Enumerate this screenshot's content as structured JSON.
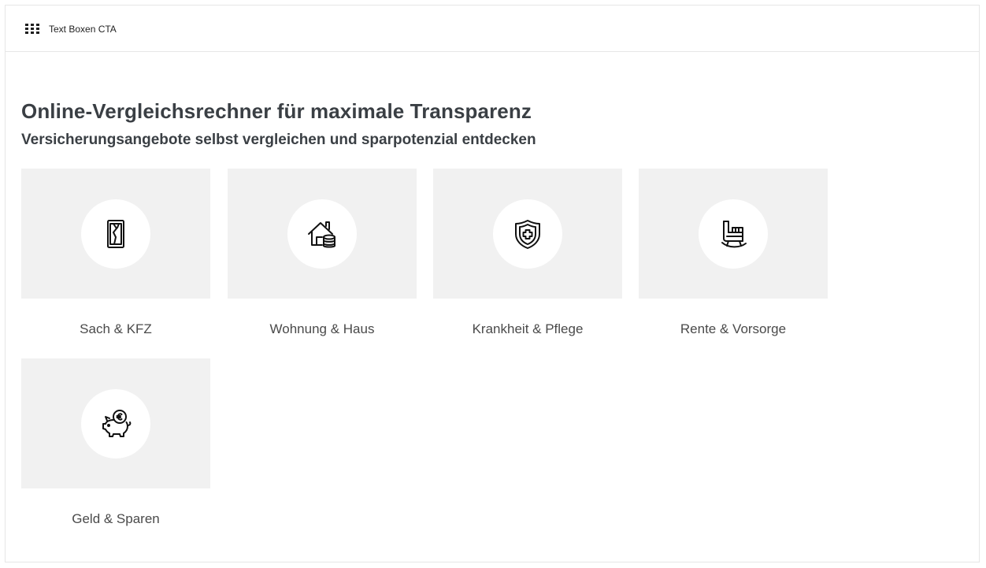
{
  "topbar": {
    "icon": "grid-icon",
    "title": "Text Boxen CTA"
  },
  "main": {
    "title": "Online-Vergleichsrechner für maximale Transparenz",
    "subtitle": "Versicherungsangebote selbst vergleichen und sparpotenzial entdecken"
  },
  "cards": [
    {
      "label": "Sach & KFZ",
      "icon": "broken-phone-icon"
    },
    {
      "label": "Wohnung & Haus",
      "icon": "house-coins-icon"
    },
    {
      "label": "Krankheit & Pflege",
      "icon": "shield-cross-icon"
    },
    {
      "label": "Rente & Vorsorge",
      "icon": "rocking-chair-icon"
    },
    {
      "label": "Geld & Sparen",
      "icon": "piggy-bank-euro-icon"
    }
  ]
}
